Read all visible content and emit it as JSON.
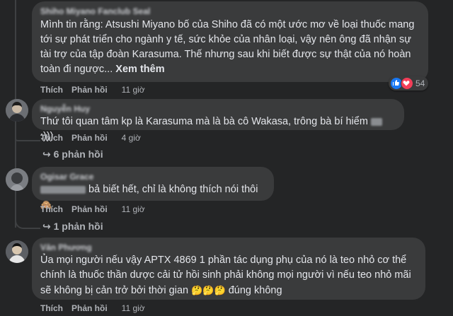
{
  "comments": [
    {
      "name": "Shiho Miyano Fanclub Seal",
      "text": "Mình tin rằng: Atsushi Miyano bố của Shiho đã có một ước mơ về loại thuốc mang tới sự phát triển cho ngành y tế, sức khỏe của nhân loại, vậy nên ông đã nhận sự tài trợ của tập đoàn Karasuma. Thế nhưng sau khi biết được sự thật của nó hoàn toàn đi ngược...",
      "see_more": "Xem thêm",
      "like": "Thích",
      "reply": "Phản hồi",
      "time": "11 giờ",
      "reaction_count": "54"
    },
    {
      "name": "Nguyễn Huy",
      "text": "Thứ tôi quan tâm kp là Karasuma mà là bà cô Wakasa, trông bà bí hiểm",
      "text_suffix": ":)))",
      "like": "Thích",
      "reply": "Phản hồi",
      "time": "4 giờ",
      "replies_label": "6 phản hồi"
    },
    {
      "name": "Ogisar Grace",
      "text": "bả biết hết, chỉ là không thích nói thôi",
      "emoji": "🙈",
      "like": "Thích",
      "reply": "Phản hồi",
      "time": "11 giờ",
      "replies_label": "1 phản hồi"
    },
    {
      "name": "Văn Phương",
      "text": "Ủa mọi người nếu vậy APTX 4869 1 phần tác dụng phụ của nó là teo nhỏ cơ thể chính là thuốc thần dược cải tử hồi sinh phải không mọi người vì nếu teo nhỏ mãi sẽ không bị cản trở bởi thời gian",
      "emoji": "🤔🤔🤔",
      "text_suffix": "đúng không",
      "like": "Thích",
      "reply": "Phản hồi",
      "time": "11 giờ"
    }
  ],
  "colors": {
    "background": "#242526",
    "bubble": "#3a3b3c",
    "text": "#e4e6eb",
    "secondary": "#b0b3b8",
    "like_blue": "#1877f2",
    "love_red": "#f33e58"
  }
}
